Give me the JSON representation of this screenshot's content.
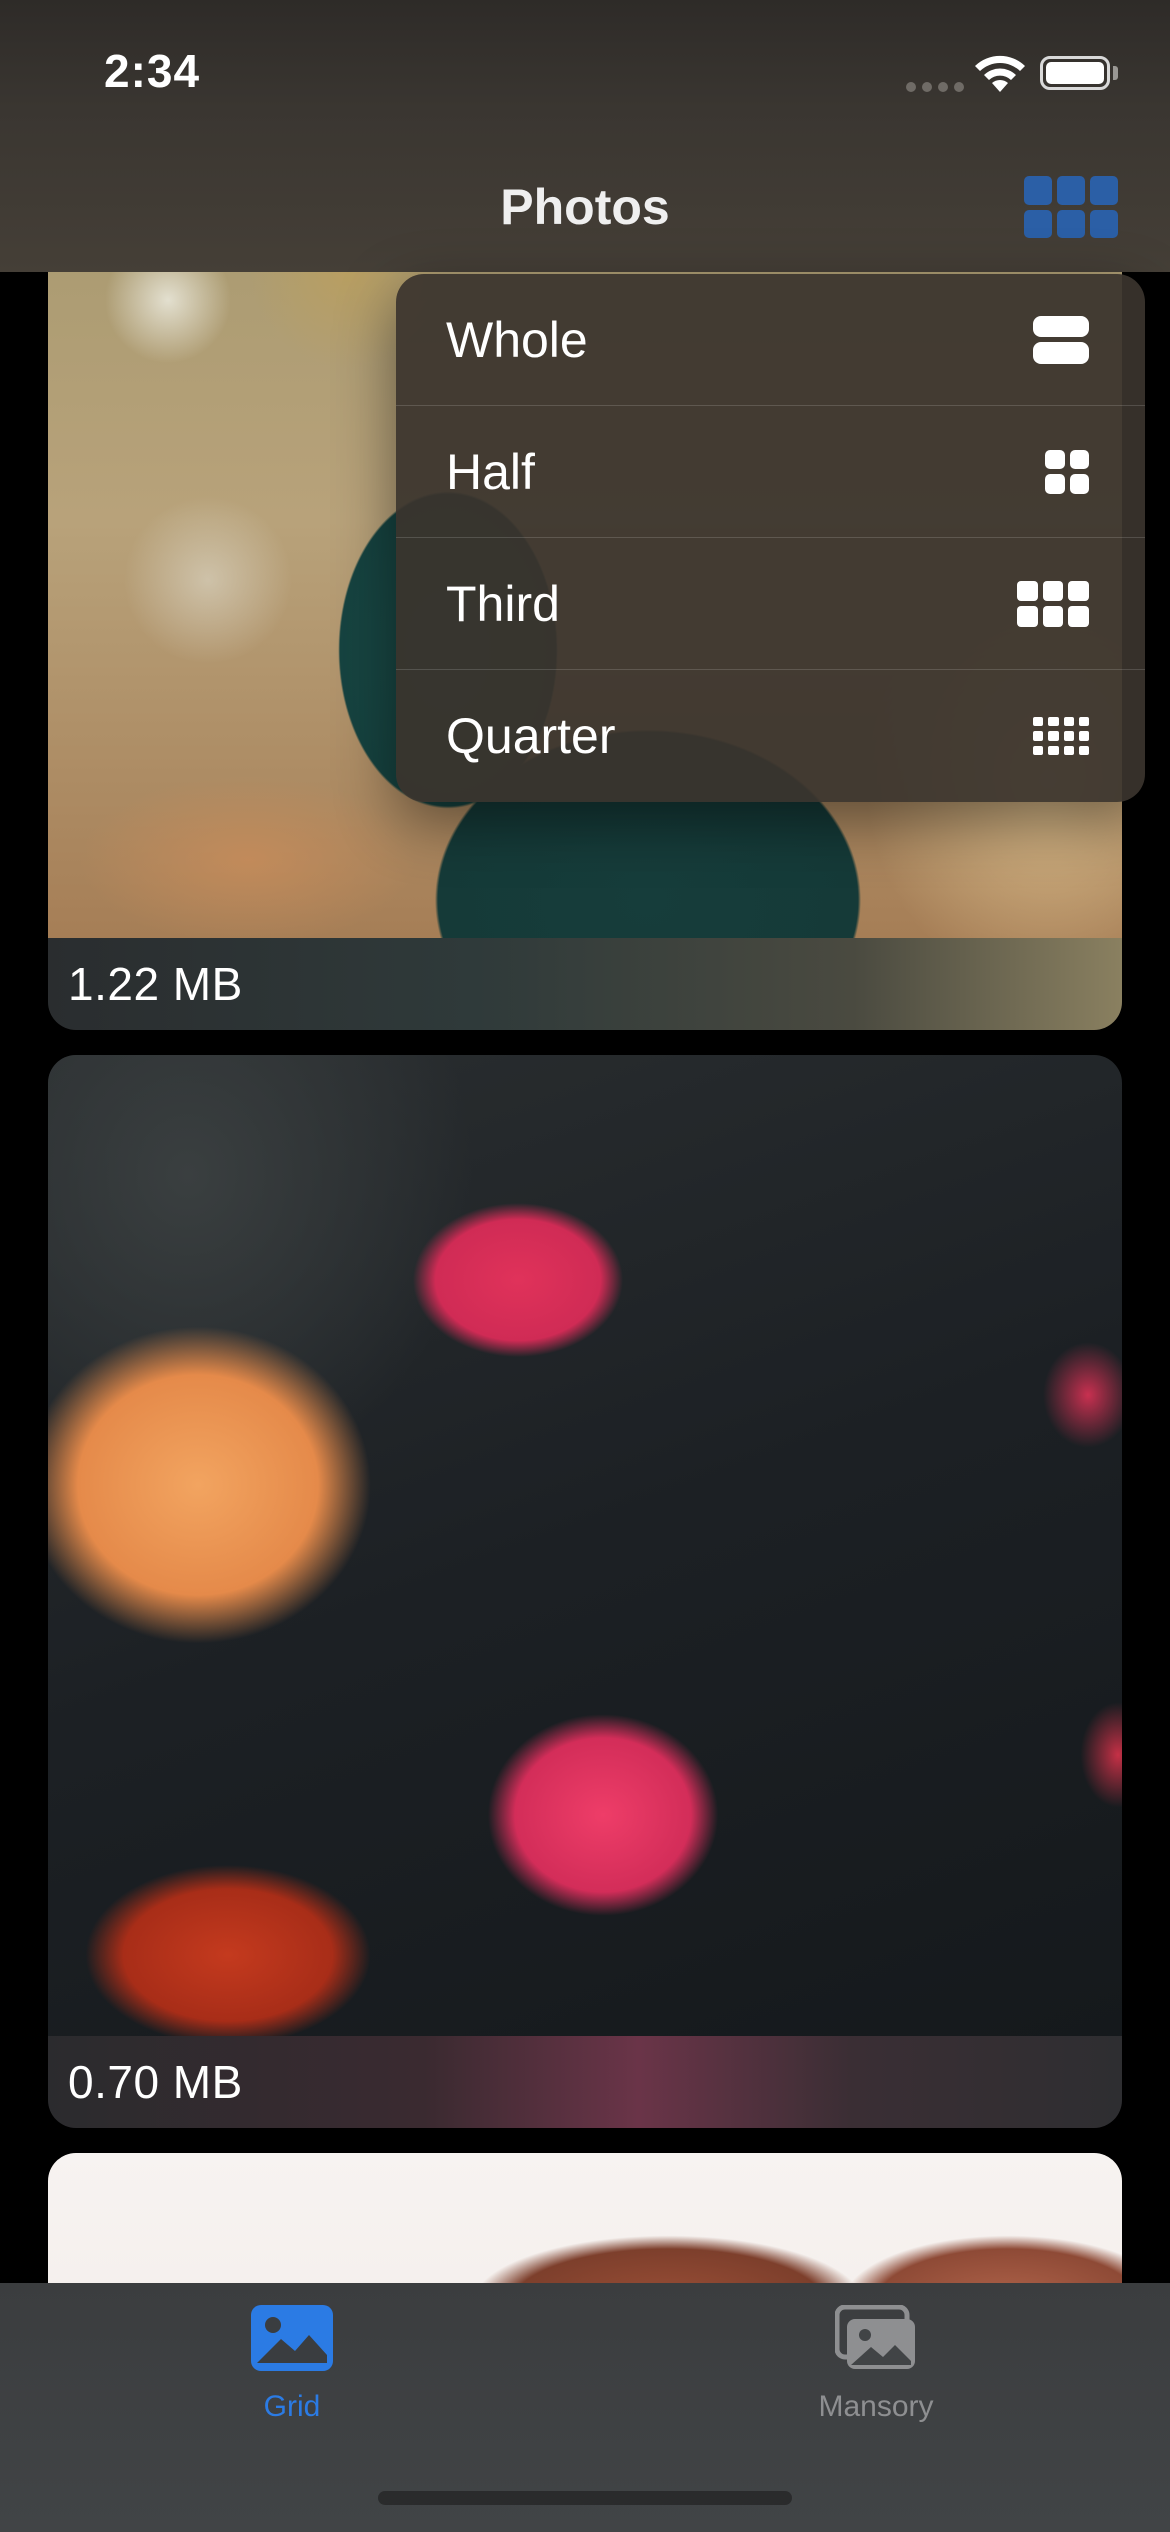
{
  "status_bar": {
    "time": "2:34"
  },
  "nav": {
    "title": "Photos",
    "layout_button_icon": "grid-3x2-icon",
    "accent_color": "#2b5fa6"
  },
  "layout_menu": {
    "items": [
      {
        "label": "Whole",
        "icon": "rows-2-icon"
      },
      {
        "label": "Half",
        "icon": "grid-2x2-icon"
      },
      {
        "label": "Third",
        "icon": "grid-3x2-icon"
      },
      {
        "label": "Quarter",
        "icon": "grid-4x3-icon"
      }
    ]
  },
  "photos": [
    {
      "size": "1.22 MB"
    },
    {
      "size": "0.70 MB"
    },
    {
      "size": ""
    }
  ],
  "tab_bar": {
    "tabs": [
      {
        "label": "Grid",
        "icon": "photo-icon",
        "selected": true,
        "color": "#2b7be4"
      },
      {
        "label": "Mansory",
        "icon": "photo-stack-icon",
        "selected": false,
        "color": "#8e8f91"
      }
    ]
  }
}
